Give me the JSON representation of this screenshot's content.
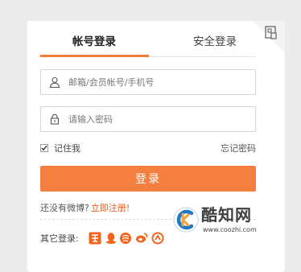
{
  "tabs": {
    "account_label": "帐号登录",
    "secure_label": "安全登录"
  },
  "username": {
    "placeholder": "邮箱/会员帐号/手机号",
    "value": "",
    "icon": "user-icon"
  },
  "password": {
    "placeholder": "请输入密码",
    "value": "",
    "icon": "lock-icon"
  },
  "remember": {
    "label": "记住我",
    "checked": true
  },
  "forgot_label": "忘记密码",
  "login_button_label": "登录",
  "signup": {
    "prompt": "还没有微博?",
    "link_label": "立即注册!"
  },
  "other_login": {
    "label": "其它登录:",
    "providers": [
      "taobao-icon",
      "qq-icon",
      "alipay-icon",
      "weibo-icon",
      "renren-icon"
    ]
  },
  "watermark": {
    "name": "酷知网",
    "url": "www.coozhi.com"
  },
  "colors": {
    "accent": "#f57f3e",
    "link": "#e6601d"
  }
}
